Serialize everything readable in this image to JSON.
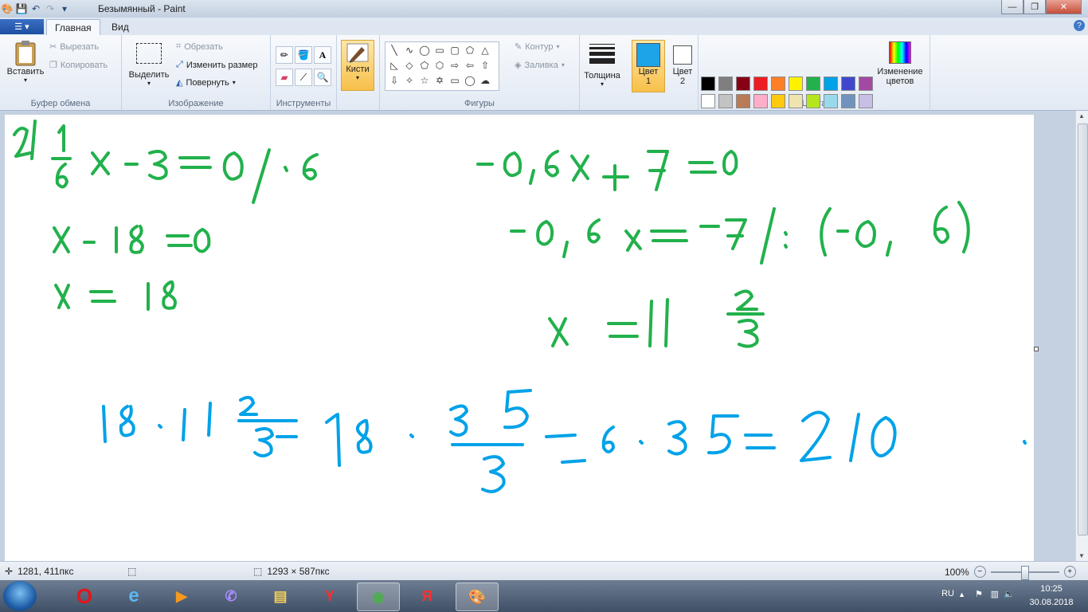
{
  "window": {
    "title": "Безымянный - Paint"
  },
  "tabs": {
    "file_icon": "menu-icon",
    "home": "Главная",
    "view": "Вид"
  },
  "ribbon": {
    "clipboard": {
      "label": "Буфер обмена",
      "paste": "Вставить",
      "cut": "Вырезать",
      "copy": "Копировать"
    },
    "image": {
      "label": "Изображение",
      "select": "Выделить",
      "crop": "Обрезать",
      "resize": "Изменить размер",
      "rotate": "Повернуть"
    },
    "tools": {
      "label": "Инструменты"
    },
    "brushes": "Кисти",
    "shapes": {
      "label": "Фигуры",
      "outline": "Контур",
      "fill": "Заливка"
    },
    "size": "Толщина",
    "color1": {
      "label": "Цвет",
      "num": "1",
      "value": "#1ca3e8"
    },
    "color2": {
      "label": "Цвет",
      "num": "2",
      "value": "#ffffff"
    },
    "colors": {
      "label": "Цвета",
      "edit": "Изменение цветов",
      "palette_row1": [
        "#000000",
        "#7f7f7f",
        "#880015",
        "#ed1c24",
        "#ff7f27",
        "#fff200",
        "#22b14c",
        "#00a2e8",
        "#3f48cc",
        "#a349a4"
      ],
      "palette_row2": [
        "#ffffff",
        "#c3c3c3",
        "#b97a57",
        "#ffaec9",
        "#ffc90e",
        "#efe4b0",
        "#b5e61d",
        "#99d9ea",
        "#7092be",
        "#c8bfe7"
      ]
    }
  },
  "status": {
    "cursor_pos": "1281, 411пкс",
    "image_size": "1293 × 587пкс",
    "zoom": "100%"
  },
  "taskbar": {
    "lang": "RU",
    "time": "10:25",
    "date": "30.08.2018"
  },
  "ink": {
    "green": "#22b14c",
    "blue": "#00a2e8"
  }
}
